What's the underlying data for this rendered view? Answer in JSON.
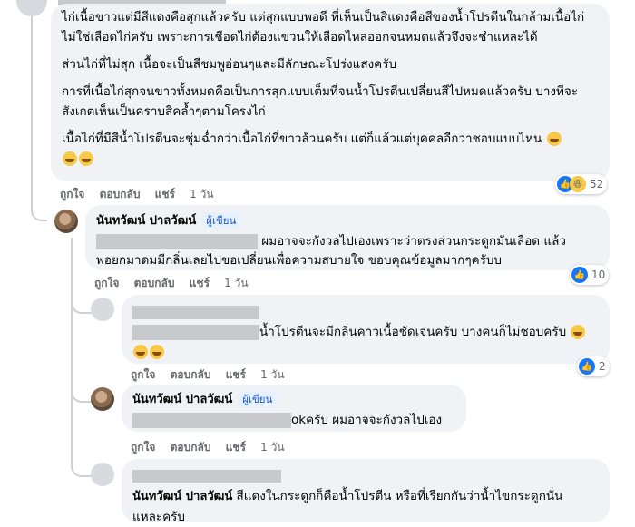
{
  "comment_main": {
    "paragraphs": [
      "ไก่เนื้อขาวแต่มีสีแดงคือสุกแล้วครับ แต่สุกแบบพอดี ที่เห็นเป็นสีแดงคือสีของน้ำโปรตีนในกล้ามเนื้อไก่ ไม่ใช่เลือดไก่ครับ เพราะการเชือดไก่ต้องแขวนให้เลือดไหลออกจนหมดแล้วจึงจะชำแหละได้",
      "ส่วนไก่ที่ไม่สุก เนื้อจะเป็นสีชมพูอ่อนๆและมีลักษณะโปร่งแสงครับ",
      "การที่เนื้อไก่สุกจนขาวทั้งหมดคือเป็นการสุกแบบเต็มที่จนน้ำโปรตีนเปลี่ยนสีไปหมดแล้วครับ บางทีจะสังเกตเห็นเป็นคราบสีคล้ำๆตามโครงไก่",
      "เนื้อไก่ที่มีสีน้ำโปรตีนจะชุ่มฉ่ำกว่าเนื้อไก่ที่ขาวล้วนครับ แต่ก็แล้วแต่บุคคลอีกว่าชอบแบบไหน"
    ],
    "reaction_count": "52",
    "actions": {
      "like": "ถูกใจ",
      "reply": "ตอบกลับ",
      "share": "แชร์",
      "time": "1 วัน"
    }
  },
  "reply_1": {
    "author": "นันทวัฒน์ ปาลวัฒน์",
    "badge": "ผู้เขียน",
    "text_line1": "ผมอาจจะกังวลไปเองเพราะว่าตรงส่วนกระดูกมันเลือด แล้ว",
    "text_line2": "พอยกมาดมมีกลิ่นเลยไปขอเปลี่ยนเพื่อความสบายใจ ขอบคุณข้อมูลมากๆครับบ",
    "reaction_count": "10",
    "actions": {
      "like": "ถูกใจ",
      "reply": "ตอบกลับ",
      "share": "แชร์",
      "time": "1 วัน"
    }
  },
  "reply_2": {
    "text": "น้ำโปรตีนจะมีกลิ่นคาวเนื้อชัดเจนครับ บางคนก็ไม่ชอบครับ",
    "reaction_count": "2",
    "actions": {
      "like": "ถูกใจ",
      "reply": "ตอบกลับ",
      "share": "แชร์",
      "time": "1 วัน"
    }
  },
  "reply_3": {
    "author": "นันทวัฒน์ ปาลวัฒน์",
    "badge": "ผู้เขียน",
    "text": "okครับ ผมอาจจะกังวลไปเอง",
    "actions": {
      "like": "ถูกใจ",
      "reply": "ตอบกลับ",
      "share": "แชร์",
      "time": "1 วัน"
    }
  },
  "reply_4": {
    "mention": "นันทวัฒน์ ปาลวัฒน์",
    "text_line1": "สีแดงในกระดูกก็คือน้ำโปรตีน หรือที่เรียกกันว่าน้ำไขกระดูกนั่น",
    "text_line2": "แหละครับ"
  },
  "colors": {
    "bubble": "#f0f2f5",
    "link_blue": "#1877f2",
    "meta_gray": "#65676b",
    "redaction": "#c8c9cc"
  }
}
